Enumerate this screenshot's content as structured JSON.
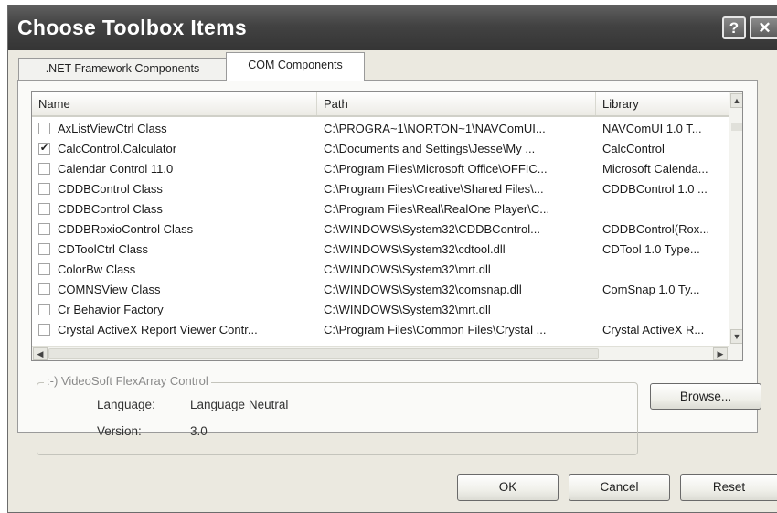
{
  "window": {
    "title": "Choose Toolbox Items",
    "help_glyph": "?",
    "close_glyph": "✕"
  },
  "tabs": [
    {
      "label": ".NET Framework Components",
      "selected": false
    },
    {
      "label": "COM Components",
      "selected": true
    }
  ],
  "list": {
    "columns": {
      "name": "Name",
      "path": "Path",
      "library": "Library"
    },
    "rows": [
      {
        "checked": false,
        "name": "AxListViewCtrl Class",
        "path": "C:\\PROGRA~1\\NORTON~1\\NAVComUI...",
        "library": "NAVComUI 1.0 T..."
      },
      {
        "checked": true,
        "name": "CalcControl.Calculator",
        "path": "C:\\Documents and Settings\\Jesse\\My ...",
        "library": "CalcControl"
      },
      {
        "checked": false,
        "name": "Calendar Control 11.0",
        "path": "C:\\Program Files\\Microsoft Office\\OFFIC...",
        "library": "Microsoft Calenda..."
      },
      {
        "checked": false,
        "name": "CDDBControl Class",
        "path": "C:\\Program Files\\Creative\\Shared Files\\...",
        "library": "CDDBControl 1.0 ..."
      },
      {
        "checked": false,
        "name": "CDDBControl Class",
        "path": "C:\\Program Files\\Real\\RealOne Player\\C...",
        "library": ""
      },
      {
        "checked": false,
        "name": "CDDBRoxioControl Class",
        "path": "C:\\WINDOWS\\System32\\CDDBControl...",
        "library": "CDDBControl(Rox..."
      },
      {
        "checked": false,
        "name": "CDToolCtrl Class",
        "path": "C:\\WINDOWS\\System32\\cdtool.dll",
        "library": "CDTool 1.0 Type..."
      },
      {
        "checked": false,
        "name": "ColorBw Class",
        "path": "C:\\WINDOWS\\System32\\mrt.dll",
        "library": ""
      },
      {
        "checked": false,
        "name": "COMNSView Class",
        "path": "C:\\WINDOWS\\System32\\comsnap.dll",
        "library": "ComSnap 1.0 Ty..."
      },
      {
        "checked": false,
        "name": "Cr Behavior Factory",
        "path": "C:\\WINDOWS\\System32\\mrt.dll",
        "library": ""
      },
      {
        "checked": false,
        "name": "Crystal ActiveX Report Viewer Contr...",
        "path": "C:\\Program Files\\Common Files\\Crystal ...",
        "library": "Crystal ActiveX R..."
      }
    ]
  },
  "details": {
    "legend": ":-) VideoSoft FlexArray Control",
    "language_label": "Language:",
    "language_value": "Language Neutral",
    "version_label": "Version:",
    "version_value": "3.0"
  },
  "buttons": {
    "browse": "Browse...",
    "ok": "OK",
    "cancel": "Cancel",
    "reset": "Reset"
  },
  "scroll_glyphs": {
    "up": "▲",
    "down": "▼",
    "left": "◀",
    "right": "▶"
  }
}
